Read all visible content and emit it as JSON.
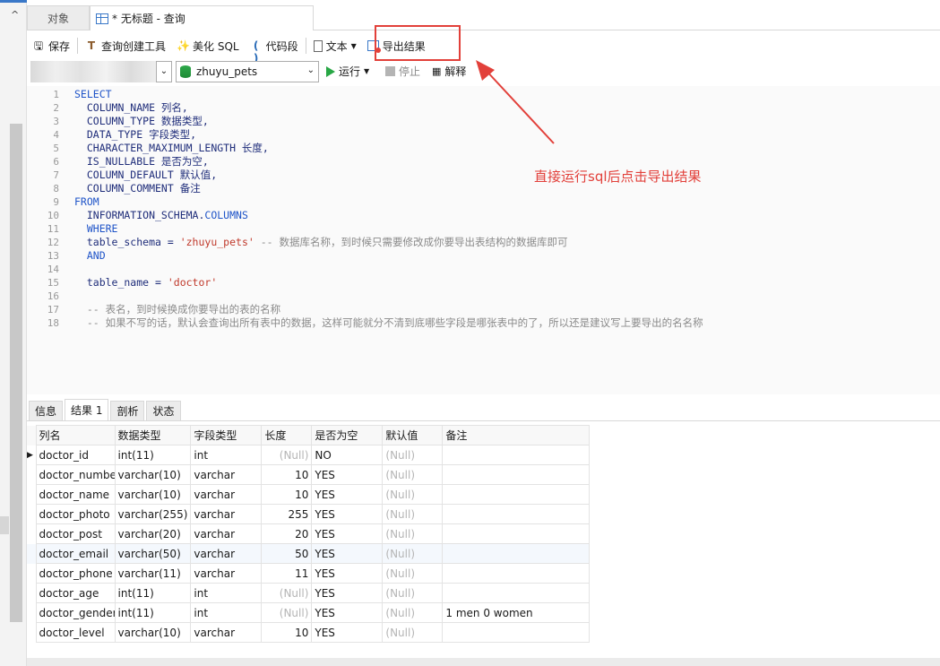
{
  "tabs": {
    "objects": "对象",
    "query": "* 无标题 - 查询"
  },
  "toolbar": {
    "save": "保存",
    "query_builder": "查询创建工具",
    "beautify": "美化 SQL",
    "snippet": "代码段",
    "text": "文本",
    "export": "导出结果"
  },
  "connection": {
    "database": "zhuyu_pets",
    "run": "运行",
    "stop": "停止",
    "explain": "解释"
  },
  "editor": {
    "line_numbers": [
      "1",
      "2",
      "3",
      "4",
      "5",
      "6",
      "7",
      "8",
      "9",
      "10",
      "11",
      "12",
      "13",
      "14",
      "15",
      "16",
      "17",
      "18"
    ]
  },
  "annotation": "直接运行sql后点击导出结果",
  "result_tabs": [
    "信息",
    "结果 1",
    "剖析",
    "状态"
  ],
  "table": {
    "headers": [
      "列名",
      "数据类型",
      "字段类型",
      "长度",
      "是否为空",
      "默认值",
      "备注"
    ],
    "null_text": "(Null)",
    "rows": [
      [
        "doctor_id",
        "int(11)",
        "int",
        "(Null)",
        "NO",
        "(Null)",
        ""
      ],
      [
        "doctor_numbe",
        "varchar(10)",
        "varchar",
        "10",
        "YES",
        "(Null)",
        ""
      ],
      [
        "doctor_name",
        "varchar(10)",
        "varchar",
        "10",
        "YES",
        "(Null)",
        ""
      ],
      [
        "doctor_photo",
        "varchar(255)",
        "varchar",
        "255",
        "YES",
        "(Null)",
        ""
      ],
      [
        "doctor_post",
        "varchar(20)",
        "varchar",
        "20",
        "YES",
        "(Null)",
        ""
      ],
      [
        "doctor_email",
        "varchar(50)",
        "varchar",
        "50",
        "YES",
        "(Null)",
        ""
      ],
      [
        "doctor_phone",
        "varchar(11)",
        "varchar",
        "11",
        "YES",
        "(Null)",
        ""
      ],
      [
        "doctor_age",
        "int(11)",
        "int",
        "(Null)",
        "YES",
        "(Null)",
        ""
      ],
      [
        "doctor_gender",
        "int(11)",
        "int",
        "(Null)",
        "YES",
        "(Null)",
        "1 men 0 women"
      ],
      [
        "doctor_level",
        "varchar(10)",
        "varchar",
        "10",
        "YES",
        "(Null)",
        ""
      ]
    ]
  },
  "colors": {
    "accent": "#3a78c8",
    "annotation": "#e2403a",
    "run": "#28a745"
  }
}
